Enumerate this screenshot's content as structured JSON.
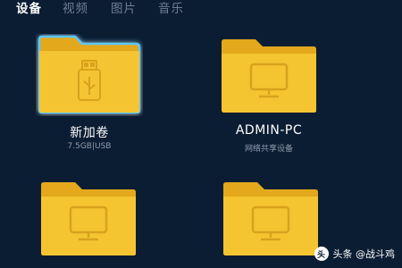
{
  "tabs": [
    {
      "label": "设备"
    },
    {
      "label": "视频"
    },
    {
      "label": "图片"
    },
    {
      "label": "音乐"
    }
  ],
  "devices": [
    {
      "name": "新加卷",
      "detail": "7.5GB|USB",
      "icon": "usb-drive-icon",
      "selected": true
    },
    {
      "name": "ADMIN-PC",
      "detail": "网络共享设备",
      "icon": "monitor-icon",
      "selected": false
    },
    {
      "name": "",
      "detail": "",
      "icon": "monitor-icon",
      "selected": false
    },
    {
      "name": "",
      "detail": "",
      "icon": "monitor-icon",
      "selected": false
    }
  ],
  "watermark": {
    "text": "头条 @战斗鸡",
    "logo": "头"
  },
  "colors": {
    "background": "#0b1d33",
    "folder_front": "#f5c431",
    "folder_back": "#e3a81c",
    "selection_glow": "#5cc8ff",
    "active_tab": "#ffffff",
    "inactive_tab": "#6f7f92"
  }
}
